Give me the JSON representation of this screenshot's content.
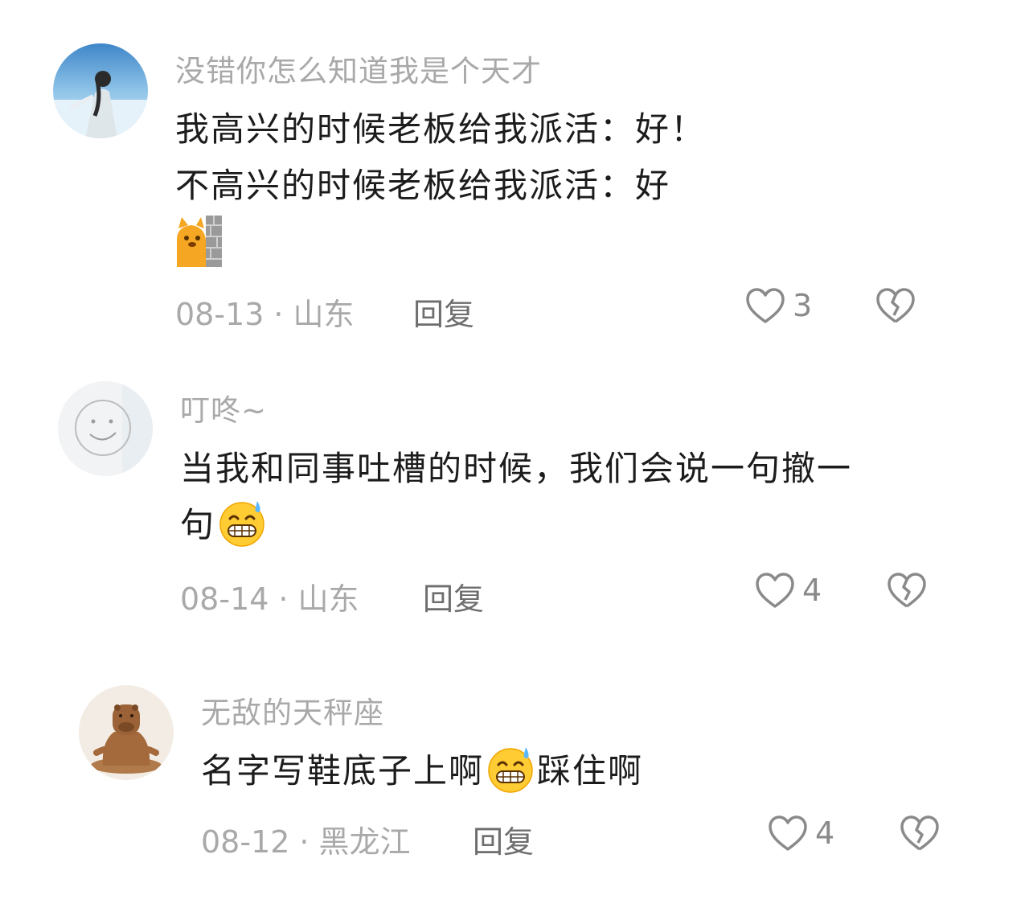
{
  "comments": [
    {
      "username": "没错你怎么知道我是个天才",
      "lines": [
        "我高兴的时候老板给我派活：好！",
        "不高兴的时候老板给我派活：好"
      ],
      "sticker": "peeking-cat-sticker",
      "date": "08-13",
      "separator": "·",
      "location": "山东",
      "reply_label": "回复",
      "likes": "3"
    },
    {
      "username": "叮咚~",
      "line1": "当我和同事吐槽的时候，我们会说一句撤一",
      "line2": "句",
      "emoji": "grimacing-sweat-emoji",
      "date": "08-14",
      "separator": "·",
      "location": "山东",
      "reply_label": "回复",
      "likes": "4"
    },
    {
      "username": "无敌的天秤座",
      "text_before": "名字写鞋底子上啊",
      "emoji": "grimacing-sweat-emoji",
      "text_after": "踩住啊",
      "date": "08-12",
      "separator": "·",
      "location": "黑龙江",
      "reply_label": "回复",
      "likes": "4"
    }
  ],
  "colors": {
    "username": "#a9a9a9",
    "body": "#1c1c1c",
    "meta": "#a9a9a9",
    "reply": "#6e6e6e",
    "icon": "#8a8a8a"
  }
}
